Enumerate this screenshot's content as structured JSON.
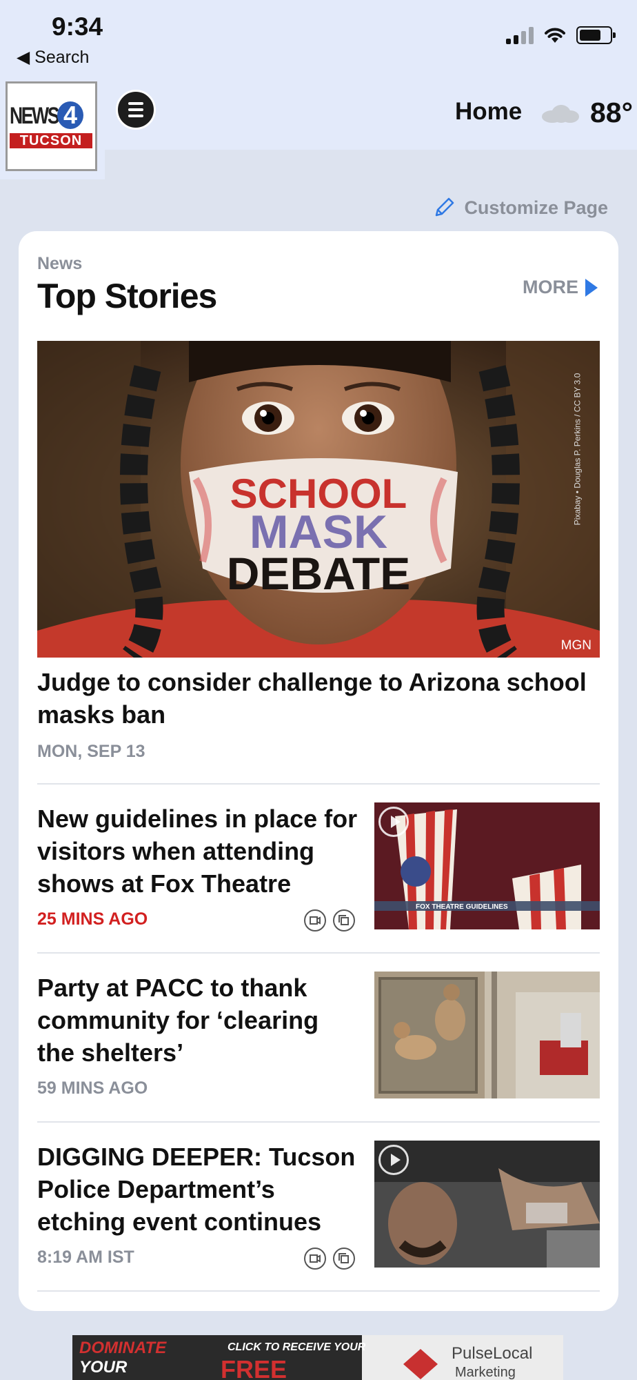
{
  "status": {
    "time": "9:34",
    "back_label": "◀ Search"
  },
  "header": {
    "logo_text_news": "NEWS",
    "logo_text_four": "4",
    "logo_text_city": "TUCSON",
    "nav_label": "Home",
    "weather_temp": "88°",
    "weather_icon": "cloud-icon"
  },
  "customize_label": "Customize Page",
  "section": {
    "kicker": "News",
    "title": "Top Stories",
    "more_label": "MORE"
  },
  "hero": {
    "mask_line1": "SCHOOL",
    "mask_line2": "MASK",
    "mask_line3": "DEBATE",
    "credit": "MGN",
    "side_credit": "Pixabay • Douglas P. Perkins / CC BY 3.0",
    "headline": "Judge to consider challenge to Arizona school masks ban",
    "date": "MON, SEP 13"
  },
  "stories": [
    {
      "headline": "New guidelines in place for visitors when attending shows at Fox Theatre",
      "meta": "25 MINS AGO",
      "thumb_caption": "FOX THEATRE GUIDELINES",
      "has_video": true
    },
    {
      "headline": "Party at PACC to thank community for ‘clearing the shelters’",
      "meta": "59 MINS AGO",
      "has_video": false
    },
    {
      "headline": "DIGGING DEEPER: Tucson Police Department’s etching event continues",
      "meta": "8:19 AM IST",
      "has_video": true
    }
  ],
  "ad": {
    "line1": "DOMINATE",
    "line2": "YOUR",
    "mid": "CLICK TO RECEIVE YOUR",
    "free": "FREE",
    "brand1": "PulseLocal",
    "brand2": "Marketing"
  },
  "colors": {
    "accent": "#2f79e4",
    "breaking": "#d22020",
    "muted": "#8a8f99",
    "bg": "#dde3ef"
  }
}
